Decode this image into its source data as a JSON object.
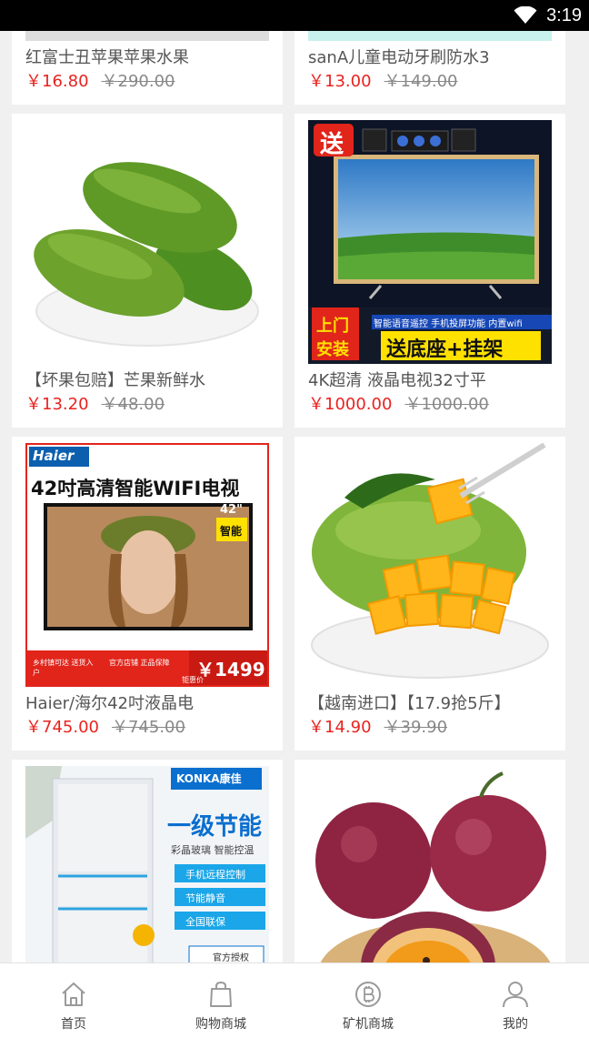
{
  "status": {
    "time": "3:19",
    "wifi_icon": "wifi-icon"
  },
  "products": [
    {
      "title": "红富士丑苹果苹果水果",
      "price": "￥16.80",
      "old_price": "￥290.00",
      "image": "apple"
    },
    {
      "title": "sanA儿童电动牙刷防水3",
      "price": "￥13.00",
      "old_price": "￥149.00",
      "image": "toothbrush"
    },
    {
      "title": "【坏果包赔】芒果新鲜水",
      "price": "￥13.20",
      "old_price": "￥48.00",
      "image": "green-mango"
    },
    {
      "title": "4K超清 液晶电视32寸平",
      "price": "￥1000.00",
      "old_price": "￥1000.00",
      "image": "tv-landscape",
      "banner": {
        "badge": "送",
        "tag_line1": "上门",
        "tag_line2": "安装",
        "strip": "智能语音遥控 手机投屏功能 内置wifi",
        "caption": "送底座+挂架"
      }
    },
    {
      "title": "Haier/海尔42吋液晶电",
      "price": "￥745.00",
      "old_price": "￥745.00",
      "image": "haier-tv",
      "banner": {
        "brand": "Haier",
        "headline": "42吋高清智能WIFI电视",
        "size_tag": "42\"",
        "smart_tag": "智能",
        "service1": "乡村镇可达 送货入户",
        "service2": "官方店铺 正品保障",
        "promo_price": "￥1499",
        "promo_label": "钜惠价"
      }
    },
    {
      "title": "【越南进口】【17.9抢5斤】",
      "price": "￥14.90",
      "old_price": "￥39.90",
      "image": "cut-mango"
    },
    {
      "title": "",
      "price": "",
      "old_price": "",
      "image": "fridge",
      "banner": {
        "brand": "KONKA康佳",
        "headline": "一级节能",
        "sub": "彩晶玻璃 智能控温",
        "feature1": "手机远程控制",
        "feature2": "节能静音",
        "feature3": "全国联保",
        "sticker": "官方授权"
      }
    },
    {
      "title": "",
      "price": "",
      "old_price": "",
      "image": "passion-fruit"
    }
  ],
  "tabs": [
    {
      "label": "首页",
      "icon": "home-icon"
    },
    {
      "label": "购物商城",
      "icon": "shopping-bag-icon"
    },
    {
      "label": "矿机商城",
      "icon": "bitcoin-icon"
    },
    {
      "label": "我的",
      "icon": "user-icon"
    }
  ]
}
